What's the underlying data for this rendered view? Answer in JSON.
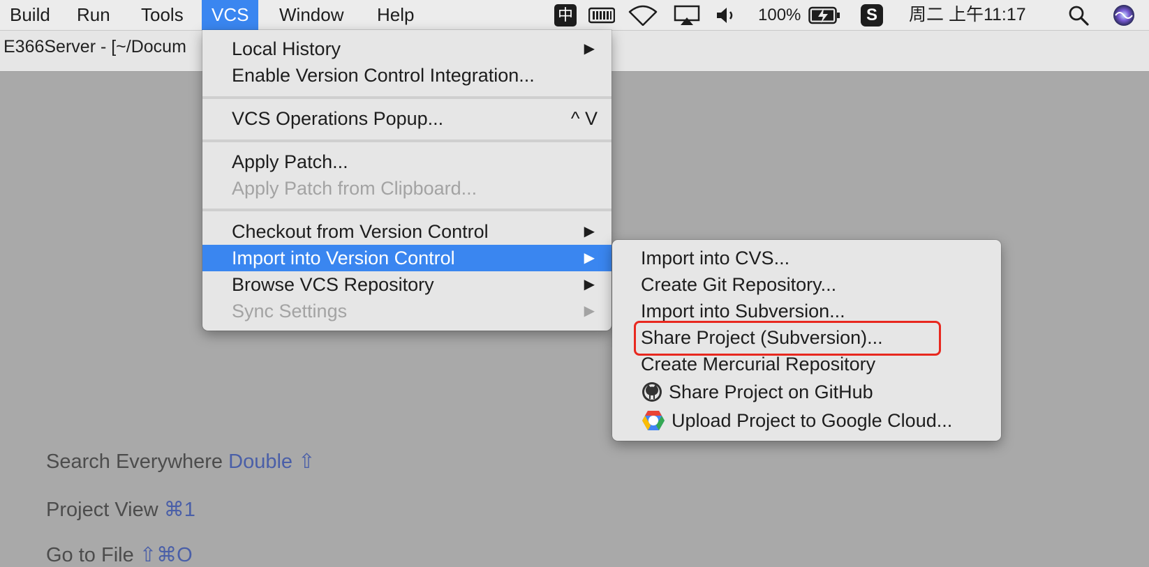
{
  "menubar": {
    "items": [
      "Build",
      "Run",
      "Tools",
      "VCS",
      "Window",
      "Help"
    ],
    "active": "VCS",
    "status": {
      "input_method": "中",
      "battery_percent": "100%",
      "clock": "周二 上午11:17"
    }
  },
  "window": {
    "title": "E366Server - [~/Docum"
  },
  "vcs_menu": {
    "local_history": "Local History",
    "enable_vcs": "Enable Version Control Integration...",
    "vcs_operations_popup": "VCS Operations Popup...",
    "vcs_operations_shortcut": "^ V",
    "apply_patch": "Apply Patch...",
    "apply_patch_clipboard": "Apply Patch from Clipboard...",
    "checkout": "Checkout from Version Control",
    "import_into_vc": "Import into Version Control",
    "browse_repo": "Browse VCS Repository",
    "sync_settings": "Sync Settings"
  },
  "import_submenu": {
    "import_cvs": "Import into CVS...",
    "create_git": "Create Git Repository...",
    "import_subversion": "Import into Subversion...",
    "share_subversion": "Share Project (Subversion)...",
    "create_mercurial": "Create Mercurial Repository",
    "share_github": "Share Project on GitHub",
    "upload_google_cloud": "Upload Project to Google Cloud..."
  },
  "hints": {
    "search_everywhere": {
      "label": "Search Everywhere",
      "key": "Double ⇧"
    },
    "project_view": {
      "label": "Project View",
      "key": "⌘1"
    },
    "goto_file": {
      "label": "Go to File",
      "key": "⇧⌘O"
    }
  },
  "colors": {
    "accent": "#3a86f0",
    "highlight_box": "#e8281f",
    "shortcut_text": "#4a5fa8"
  }
}
